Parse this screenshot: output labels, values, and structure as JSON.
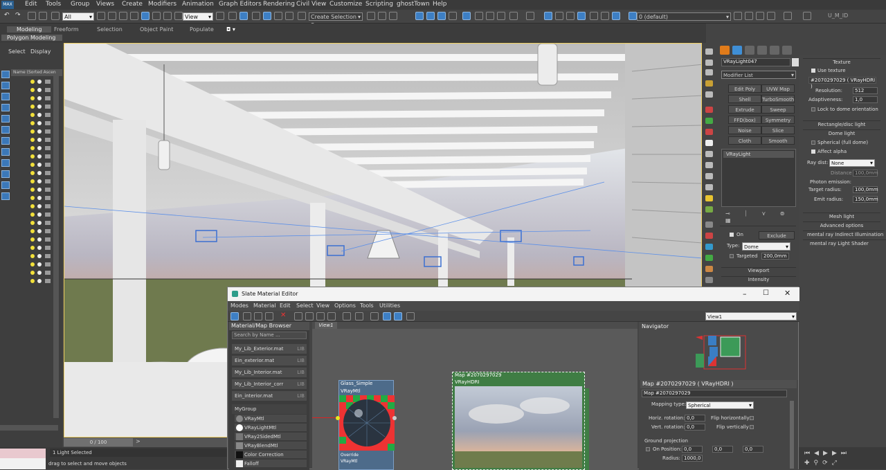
{
  "app": {
    "logo_text": "MAX"
  },
  "menu": [
    "Edit",
    "Tools",
    "Group",
    "Views",
    "Create",
    "Modifiers",
    "Animation",
    "Graph Editors",
    "Rendering",
    "Civil View",
    "Customize",
    "Scripting",
    "ghostTown",
    "Help"
  ],
  "toolbar": {
    "selection_filter": "All",
    "view_dropdown": "View",
    "selection_set": "Create Selection Se",
    "layer_dropdown": "0 (default)",
    "user_label": "U_M_ID"
  },
  "ribbon": {
    "tabs": [
      "Modeling",
      "Freeform",
      "Selection",
      "Object Paint",
      "Populate"
    ],
    "sub": "Polygon Modeling"
  },
  "scene_explorer": {
    "tabs": [
      "Select",
      "Display"
    ],
    "column": "Name (Sorted Ascen"
  },
  "timeslider": {
    "label": "0 / 100"
  },
  "command_panel": {
    "object_name": "VRayLight047",
    "modifier_list": "Modifier List",
    "modifier_buttons": [
      "Edit Poly",
      "UVW Map",
      "Shell",
      "TurboSmooth",
      "Extrude",
      "Sweep",
      "FFD(box)",
      "Symmetry",
      "Noise",
      "Slice",
      "Cloth",
      "Smooth"
    ],
    "stack_item": "VRayLight",
    "on_label": "On",
    "exclude_label": "Exclude",
    "type_label": "Type:",
    "type_value": "Dome",
    "targeted_label": "Targeted",
    "targeted_value": "200,0mm",
    "rollouts": [
      "Viewport",
      "Intensity"
    ]
  },
  "texture_panel": {
    "header": "Texture",
    "use_texture": "Use texture",
    "map_name": "#2070297029 ( VRayHDRI )",
    "resolution_label": "Resolution:",
    "resolution_value": "512",
    "adaptiveness_label": "Adaptiveness:",
    "adaptiveness_value": "1,0",
    "lock_label": "Lock to dome orientation",
    "rect_header": "Rectangle/disc light",
    "dome_header": "Dome light",
    "spherical_label": "Spherical (full dome)",
    "affect_alpha": "Affect alpha",
    "ray_dist_label": "Ray dist:",
    "ray_dist_value": "None",
    "distance_label": "Distance",
    "distance_value": "100,0mm",
    "photon_label": "Photon emission:",
    "target_radius_label": "Target radius:",
    "target_radius_value": "100,0mm",
    "emit_radius_label": "Emit radius:",
    "emit_radius_value": "150,0mm",
    "mesh_header": "Mesh light",
    "advanced_header": "Advanced options",
    "mr_indirect": "mental ray Indirect Illumination",
    "mr_shader": "mental ray Light Shader"
  },
  "slate": {
    "title": "Slate Material Editor",
    "menu": [
      "Modes",
      "Material",
      "Edit",
      "Select",
      "View",
      "Options",
      "Tools",
      "Utilities"
    ],
    "browser_title": "Material/Map Browser",
    "search_placeholder": "Search by Name ...",
    "libraries": [
      "My_Lib_Exterior.mat",
      "Ein_exterior.mat",
      "My_Lib_Interior.mat",
      "My_Lib_Interior_corr",
      "Ein_interior.mat"
    ],
    "lib_tag": "LIB",
    "group": "MyGroup",
    "materials": [
      "VRayMtl",
      "VRayLightMtl",
      "VRay2SidedMtl",
      "VRayBlendMtl",
      "Color Correction",
      "Falloff"
    ],
    "view_tab": "View1",
    "view_dropdown": "View1",
    "node1_title": "Glass_Simple",
    "node1_sub": "VRayMtl",
    "node1_extra": "Override",
    "node1_extra_sub": "VRayMtl",
    "node2_title": "Map #2070297029",
    "node2_sub": "VRayHDRI",
    "navigator": "Navigator",
    "param_title": "Map #2070297029 ( VRayHDRI )",
    "param_field": "Map #2070297029",
    "mapping_label": "Mapping type:",
    "mapping_value": "Spherical",
    "horiz_label": "Horiz. rotation:",
    "horiz_value": "0,0",
    "flip_h": "Flip horizontally",
    "vert_label": "Vert. rotation:",
    "vert_value": "0,0",
    "flip_v": "Flip vertically",
    "ground_label": "Ground projection",
    "on_label": "On",
    "position_label": "Position:",
    "pos_x": "0,0",
    "pos_y": "0,0",
    "pos_z": "0,0",
    "radius_label": "Radius:",
    "radius_value": "1000,0"
  },
  "status": {
    "selected": "1 Light Selected",
    "hint": "drag to select and move objects"
  }
}
